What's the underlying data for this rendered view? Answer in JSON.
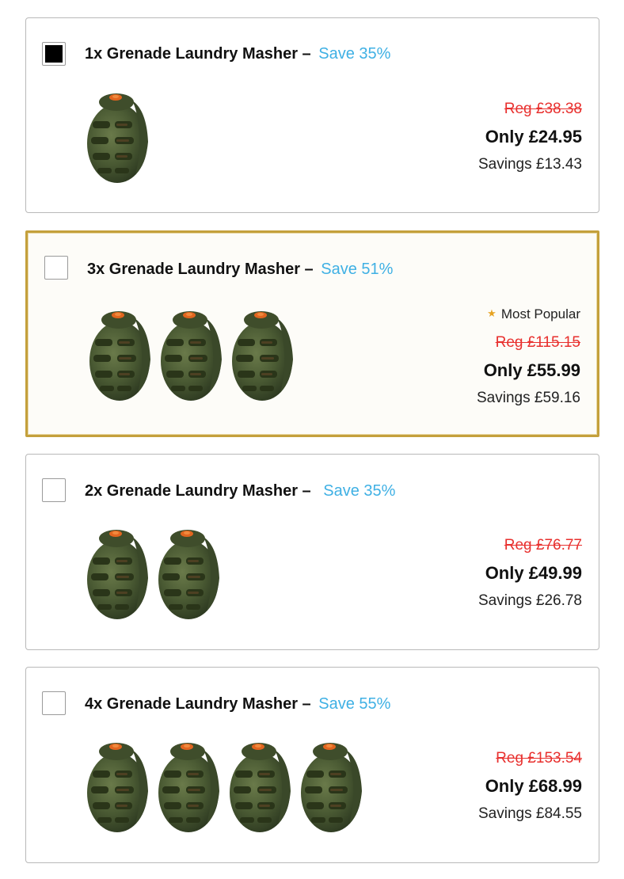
{
  "colors": {
    "save_accent": "#3fb0e4",
    "regular_price_strike": "#e8302e",
    "popular_border": "#c4a03c",
    "grenade_body": "#4a5a33",
    "grenade_cap": "#e2651f"
  },
  "offers": [
    {
      "title": "1x Grenade Laundry Masher –",
      "save": "Save 35%",
      "checked": true,
      "quantity": 1,
      "image_icon": "grenade-masher-icon",
      "regular_price": "Reg £38.38",
      "price": "Only £24.95",
      "savings": "Savings £13.43"
    },
    {
      "title": "3x Grenade Laundry Masher –",
      "save": "Save 51%",
      "checked": false,
      "quantity": 3,
      "image_icon": "grenade-masher-icon",
      "badge": "Most Popular",
      "badge_icon": "star-icon",
      "regular_price": "Reg £115.15",
      "price": "Only £55.99",
      "savings": "Savings £59.16"
    },
    {
      "title": "2x Grenade Laundry Masher –",
      "save": "Save 35%",
      "checked": false,
      "quantity": 2,
      "image_icon": "grenade-masher-icon",
      "regular_price": "Reg £76.77",
      "price": "Only £49.99",
      "savings": "Savings £26.78"
    },
    {
      "title": "4x Grenade Laundry Masher –",
      "save": "Save 55%",
      "checked": false,
      "quantity": 4,
      "image_icon": "grenade-masher-icon",
      "regular_price": "Reg £153.54",
      "price": "Only £68.99",
      "savings": "Savings £84.55"
    }
  ]
}
